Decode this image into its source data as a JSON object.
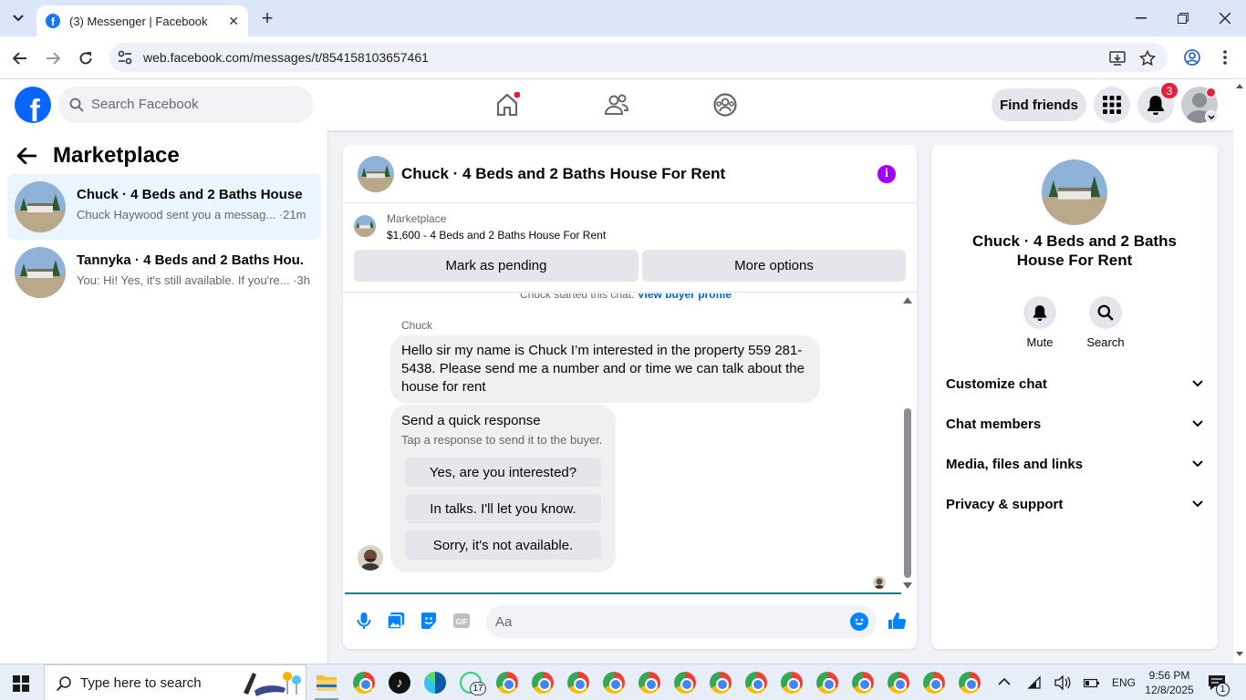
{
  "browser": {
    "tab_title": "(3) Messenger | Facebook",
    "url": "web.facebook.com/messages/t/854158103657461"
  },
  "fbnav": {
    "search_placeholder": "Search Facebook",
    "find_friends": "Find friends",
    "notification_count": "3",
    "logo_letter": "f"
  },
  "sidebar": {
    "title": "Marketplace",
    "conversations": [
      {
        "name": "Chuck · 4 Beds and 2 Baths House ...",
        "snippet": "Chuck Haywood sent you a messag... ·21m",
        "active": true
      },
      {
        "name": "Tannyka · 4 Beds and 2 Baths Hou...",
        "snippet": "You: Hi! Yes, it's still available. If you're... ·3h",
        "active": false
      }
    ]
  },
  "chat": {
    "title": "Chuck · 4 Beds and 2 Baths House For Rent",
    "marketplace_label": "Marketplace",
    "listing": "$1,600 - 4 Beds and 2 Baths House For Rent",
    "mark_pending": "Mark as pending",
    "more_options": "More options",
    "started_text": "Chuck started this chat.",
    "view_buyer_profile": "View buyer profile",
    "sender": "Chuck",
    "message": "Hello sir my name is Chuck I’m interested in the property 559 281-5438. Please send me a number and or time we can talk about the house for rent",
    "quick_title": "Send a quick response",
    "quick_subtitle": "Tap a response to send it to the buyer.",
    "quick_options": [
      "Yes, are you interested?",
      "In talks. I'll let you know.",
      "Sorry, it's not available."
    ],
    "composer_placeholder": "Aa"
  },
  "info": {
    "name": "Chuck · 4 Beds and 2 Baths House For Rent",
    "mute": "Mute",
    "search": "Search",
    "sections": [
      "Customize chat",
      "Chat members",
      "Media, files and links",
      "Privacy & support"
    ]
  },
  "taskbar": {
    "search_placeholder": "Type here to search",
    "whatsapp_badge": "17",
    "lang": "ENG",
    "time": "9:56 PM",
    "date": "12/8/2025",
    "notif_count": "1"
  },
  "colors": {
    "fb_blue": "#0866ff",
    "messenger_blue": "#0084ff",
    "info_purple": "#a400ff",
    "notif_red": "#e41e3f"
  }
}
